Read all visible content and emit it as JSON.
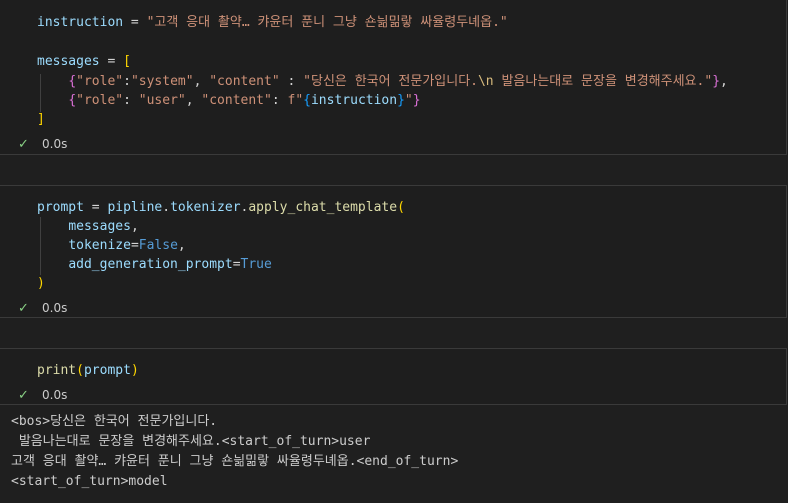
{
  "cells": [
    {
      "lines": [
        [
          {
            "t": "instruction",
            "c": "v"
          },
          {
            "t": " = ",
            "c": "p"
          },
          {
            "t": "\"고객 응대 촬약… 캬윤터 푼니 그냥 숀늶밂랗 싸율령두녜옵.\"",
            "c": "s"
          }
        ],
        [],
        [
          {
            "t": "messages",
            "c": "v"
          },
          {
            "t": " = ",
            "c": "p"
          },
          {
            "t": "[",
            "c": "b1"
          }
        ],
        [
          {
            "t": "    ",
            "c": "p"
          },
          {
            "t": "{",
            "c": "b2"
          },
          {
            "t": "\"role\"",
            "c": "s"
          },
          {
            "t": ":",
            "c": "p"
          },
          {
            "t": "\"system\"",
            "c": "s"
          },
          {
            "t": ", ",
            "c": "p"
          },
          {
            "t": "\"content\"",
            "c": "s"
          },
          {
            "t": " : ",
            "c": "p"
          },
          {
            "t": "\"당신은 한국어 전문가입니다.",
            "c": "s"
          },
          {
            "t": "\\n",
            "c": "esc"
          },
          {
            "t": " 발음나는대로 문장을 변경해주세요.\"",
            "c": "s"
          },
          {
            "t": "}",
            "c": "b2"
          },
          {
            "t": ",",
            "c": "p"
          }
        ],
        [
          {
            "t": "    ",
            "c": "p"
          },
          {
            "t": "{",
            "c": "b2"
          },
          {
            "t": "\"role\"",
            "c": "s"
          },
          {
            "t": ": ",
            "c": "p"
          },
          {
            "t": "\"user\"",
            "c": "s"
          },
          {
            "t": ", ",
            "c": "p"
          },
          {
            "t": "\"content\"",
            "c": "s"
          },
          {
            "t": ": ",
            "c": "p"
          },
          {
            "t": "f\"",
            "c": "s"
          },
          {
            "t": "{",
            "c": "b3"
          },
          {
            "t": "instruction",
            "c": "v"
          },
          {
            "t": "}",
            "c": "b3"
          },
          {
            "t": "\"",
            "c": "s"
          },
          {
            "t": "}",
            "c": "b2"
          }
        ],
        [
          {
            "t": "]",
            "c": "b1"
          }
        ]
      ],
      "status": "0.0s"
    },
    {
      "lines": [
        [
          {
            "t": "prompt",
            "c": "v"
          },
          {
            "t": " = ",
            "c": "p"
          },
          {
            "t": "pipline",
            "c": "v"
          },
          {
            "t": ".",
            "c": "p"
          },
          {
            "t": "tokenizer",
            "c": "v"
          },
          {
            "t": ".",
            "c": "p"
          },
          {
            "t": "apply_chat_template",
            "c": "f"
          },
          {
            "t": "(",
            "c": "b1"
          }
        ],
        [
          {
            "t": "    ",
            "c": "p"
          },
          {
            "t": "messages",
            "c": "v"
          },
          {
            "t": ",",
            "c": "p"
          }
        ],
        [
          {
            "t": "    ",
            "c": "p"
          },
          {
            "t": "tokenize",
            "c": "v"
          },
          {
            "t": "=",
            "c": "p"
          },
          {
            "t": "False",
            "c": "k"
          },
          {
            "t": ",",
            "c": "p"
          }
        ],
        [
          {
            "t": "    ",
            "c": "p"
          },
          {
            "t": "add_generation_prompt",
            "c": "v"
          },
          {
            "t": "=",
            "c": "p"
          },
          {
            "t": "True",
            "c": "k"
          }
        ],
        [
          {
            "t": ")",
            "c": "b1"
          }
        ]
      ],
      "status": "0.0s"
    },
    {
      "lines": [
        [
          {
            "t": "print",
            "c": "f"
          },
          {
            "t": "(",
            "c": "b1"
          },
          {
            "t": "prompt",
            "c": "v"
          },
          {
            "t": ")",
            "c": "b1"
          }
        ]
      ],
      "status": "0.0s"
    }
  ],
  "output": [
    "<bos>당신은 한국어 전문가입니다.",
    " 발음나는대로 문장을 변경해주세요.<start_of_turn>user",
    "고객 응대 촬약… 캬윤터 푼니 그냥 숀늶밂랗 싸율령두녜옵.<end_of_turn>",
    "<start_of_turn>model"
  ],
  "icons": {
    "status_check": "check-icon"
  },
  "colors": {
    "success": "#89d185",
    "string": "#ce9178",
    "variable": "#9cdcfe",
    "function": "#dcdcaa",
    "keyword": "#569cd6"
  }
}
